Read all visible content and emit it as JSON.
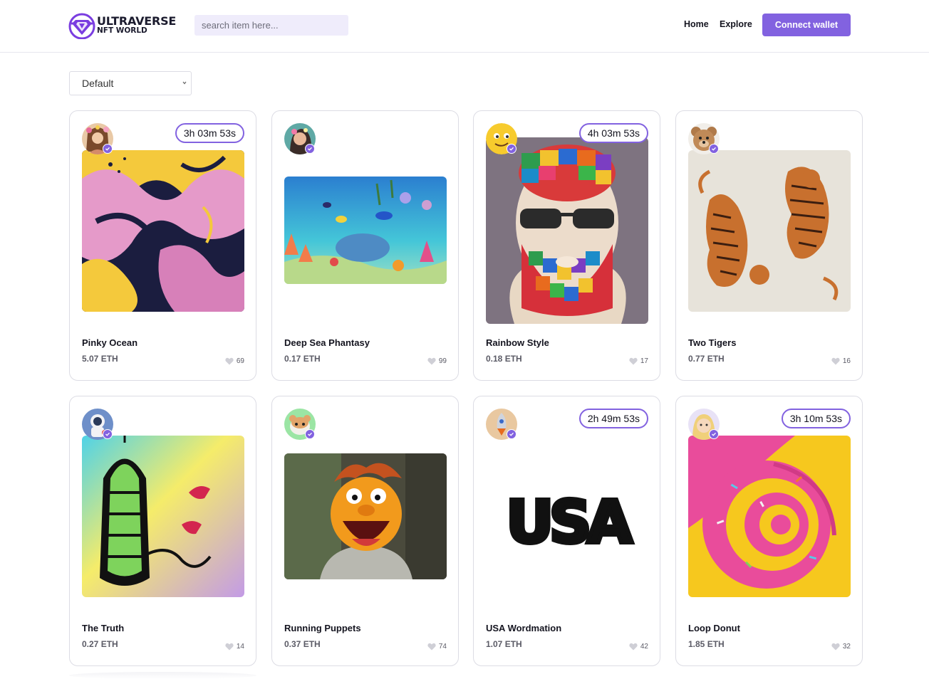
{
  "header": {
    "logo_title": "ULTRAVERSE",
    "logo_subtitle": "NFT WORLD",
    "search_placeholder": "search item here...",
    "nav_home": "Home",
    "nav_explore": "Explore",
    "connect_label": "Connect wallet"
  },
  "filter": {
    "selected": "Default"
  },
  "accent_color": "#8262e0",
  "items": [
    {
      "title": "Pinky Ocean",
      "price": "5.07 ETH",
      "likes": "69",
      "timer": "3h 03m 53s",
      "art": "pink-marble",
      "avatar": "woman-flowers"
    },
    {
      "title": "Deep Sea Phantasy",
      "price": "0.17 ETH",
      "likes": "99",
      "timer": "",
      "art": "sea-scene",
      "avatar": "woman-teal"
    },
    {
      "title": "Rainbow Style",
      "price": "0.18 ETH",
      "likes": "17",
      "timer": "4h 03m 53s",
      "art": "rainbow-face",
      "avatar": "emoji-face"
    },
    {
      "title": "Two Tigers",
      "price": "0.77 ETH",
      "likes": "16",
      "timer": "",
      "art": "two-tigers",
      "avatar": "teddy-bear"
    },
    {
      "title": "The Truth",
      "price": "0.27 ETH",
      "likes": "14",
      "timer": "",
      "art": "birdcage-lettering",
      "avatar": "astronaut"
    },
    {
      "title": "Running Puppets",
      "price": "0.37 ETH",
      "likes": "74",
      "timer": "",
      "art": "muppet",
      "avatar": "hamster"
    },
    {
      "title": "USA Wordmation",
      "price": "1.07 ETH",
      "likes": "42",
      "timer": "2h 49m 53s",
      "art": "usa-text",
      "avatar": "rocket"
    },
    {
      "title": "Loop Donut",
      "price": "1.85 ETH",
      "likes": "32",
      "timer": "3h 10m 53s",
      "art": "donut-spiral",
      "avatar": "blonde-girl"
    }
  ],
  "art_text": {
    "usa": "USA"
  }
}
